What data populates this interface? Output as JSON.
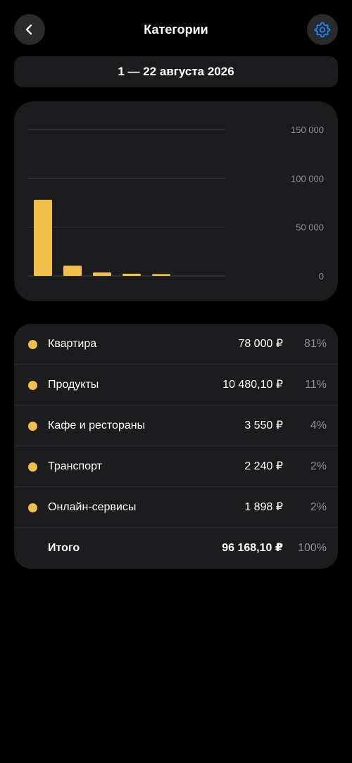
{
  "header": {
    "title": "Категории",
    "back_icon": "chevron-left-icon",
    "settings_icon": "gear-icon",
    "accent_color": "#1a8cff"
  },
  "period": {
    "label": "1 — 22 августа 2026"
  },
  "chart_data": {
    "type": "bar",
    "categories": [
      "Квартира",
      "Продукты",
      "Кафе и рестораны",
      "Транспорт",
      "Онлайн-сервисы"
    ],
    "values": [
      78000,
      10480.1,
      3550,
      2240,
      1898
    ],
    "ylim": [
      0,
      150000
    ],
    "yticks": [
      0,
      50000,
      100000,
      150000
    ],
    "ytick_labels": [
      "0",
      "50 000",
      "100 000",
      "150 000"
    ],
    "grid": true,
    "bar_color": "#f0c04a"
  },
  "categories": [
    {
      "name": "Квартира",
      "amount": "78 000 ₽",
      "percent": "81%",
      "color": "#f0c04a"
    },
    {
      "name": "Продукты",
      "amount": "10 480,10 ₽",
      "percent": "11%",
      "color": "#f0c04a"
    },
    {
      "name": "Кафе и рестораны",
      "amount": "3 550 ₽",
      "percent": "4%",
      "color": "#f0c04a"
    },
    {
      "name": "Транспорт",
      "amount": "2 240 ₽",
      "percent": "2%",
      "color": "#f0c04a"
    },
    {
      "name": "Онлайн-сервисы",
      "amount": "1 898 ₽",
      "percent": "2%",
      "color": "#f0c04a"
    }
  ],
  "total": {
    "label": "Итого",
    "amount": "96 168,10 ₽",
    "percent": "100%"
  }
}
